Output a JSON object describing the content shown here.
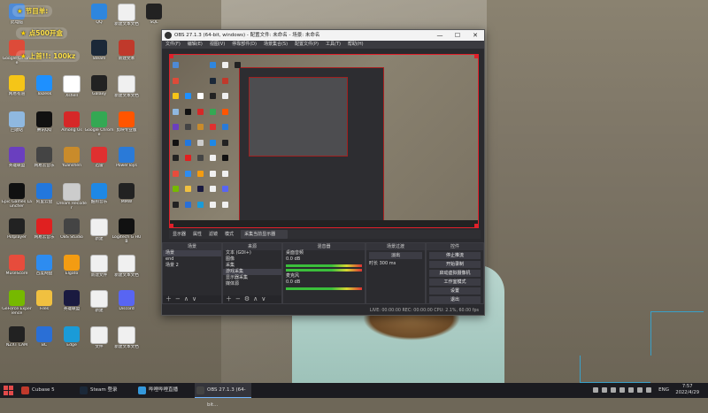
{
  "overlay": {
    "banner1": "节目单:",
    "banner2": "点500开盒",
    "banner3": "上首!!: 100kz"
  },
  "desktop_icons": [
    {
      "label": "此电脑",
      "icon": "pc-icon",
      "color": "#4e8ad6",
      "col": 0,
      "row": 0
    },
    {
      "label": "QQ",
      "icon": "qq-icon",
      "color": "#2e86de",
      "col": 3,
      "row": 0
    },
    {
      "label": "新建文本文档",
      "icon": "doc-icon",
      "color": "#f0f0f0",
      "col": 4,
      "row": 0
    },
    {
      "label": "SQL",
      "icon": "sql-icon",
      "color": "#222222",
      "col": 5,
      "row": 0
    },
    {
      "label": "Google Chrome",
      "icon": "chrome-icon",
      "color": "#dd4b39",
      "col": 0,
      "row": 1
    },
    {
      "label": "Steam",
      "icon": "steam-icon",
      "color": "#1b2838",
      "col": 3,
      "row": 1
    },
    {
      "label": "新建文本",
      "icon": "app-icon",
      "color": "#c0392b",
      "col": 4,
      "row": 1
    },
    {
      "label": "网易有道",
      "icon": "youdao-icon",
      "color": "#f5c518",
      "col": 0,
      "row": 2
    },
    {
      "label": "ToDesk",
      "icon": "todesk-icon",
      "color": "#1e90ff",
      "col": 1,
      "row": 2
    },
    {
      "label": "Xshell",
      "icon": "xshell-icon",
      "color": "#ffffff",
      "col": 2,
      "row": 2
    },
    {
      "label": "Galaxy",
      "icon": "galaxy-icon",
      "color": "#222222",
      "col": 3,
      "row": 2
    },
    {
      "label": "新建文本文档",
      "icon": "doc-icon",
      "color": "#f0f0f0",
      "col": 4,
      "row": 2
    },
    {
      "label": "回收站",
      "icon": "recycle-icon",
      "color": "#8fb8e0",
      "col": 0,
      "row": 3
    },
    {
      "label": "腾讯QQ",
      "icon": "penguin-icon",
      "color": "#111111",
      "col": 1,
      "row": 3
    },
    {
      "label": "Among Us",
      "icon": "amongus-icon",
      "color": "#d62828",
      "col": 2,
      "row": 3
    },
    {
      "label": "Google Chrome",
      "icon": "chrome-icon",
      "color": "#34a853",
      "col": 3,
      "row": 3
    },
    {
      "label": "剪映专业版",
      "icon": "cut-icon",
      "color": "#ff5500",
      "col": 4,
      "row": 3
    },
    {
      "label": "英雄联盟",
      "icon": "game-icon",
      "color": "#6a3fbf",
      "col": 0,
      "row": 4
    },
    {
      "label": "网易云音乐",
      "icon": "music-icon",
      "color": "#444444",
      "col": 1,
      "row": 4
    },
    {
      "label": "Yuanshen",
      "icon": "game-icon",
      "color": "#c98b2b",
      "col": 2,
      "row": 4
    },
    {
      "label": "迅雷",
      "icon": "xunlei-icon",
      "color": "#e03030",
      "col": 3,
      "row": 4
    },
    {
      "label": "PowerToys",
      "icon": "app-icon",
      "color": "#2a7ad8",
      "col": 4,
      "row": 4
    },
    {
      "label": "Epic Games Launcher",
      "icon": "epic-icon",
      "color": "#111111",
      "col": 0,
      "row": 5
    },
    {
      "label": "阿里云盘",
      "icon": "cloud-icon",
      "color": "#2277dd",
      "col": 1,
      "row": 5
    },
    {
      "label": "Dream Recoder",
      "icon": "app-icon",
      "color": "#cccccc",
      "col": 2,
      "row": 5
    },
    {
      "label": "酷狗音乐",
      "icon": "kugou-icon",
      "color": "#1e88e5",
      "col": 3,
      "row": 5
    },
    {
      "label": "MMW",
      "icon": "app-icon",
      "color": "#222222",
      "col": 4,
      "row": 5
    },
    {
      "label": "Potplayer",
      "icon": "chart-icon",
      "color": "#222222",
      "col": 0,
      "row": 6
    },
    {
      "label": "网易云音乐",
      "icon": "netease-icon",
      "color": "#e02020",
      "col": 1,
      "row": 6
    },
    {
      "label": "OBS Studio",
      "icon": "obs-icon",
      "color": "#444444",
      "col": 2,
      "row": 6
    },
    {
      "label": "新建",
      "icon": "doc-icon",
      "color": "#f0f0f0",
      "col": 3,
      "row": 6
    },
    {
      "label": "Logitech G HUB",
      "icon": "logitech-icon",
      "color": "#111111",
      "col": 4,
      "row": 6
    },
    {
      "label": "MuseScore",
      "icon": "app-icon",
      "color": "#e74c3c",
      "col": 0,
      "row": 7
    },
    {
      "label": "百度网盘",
      "icon": "baidu-icon",
      "color": "#2d8cf0",
      "col": 1,
      "row": 7
    },
    {
      "label": "Elgato",
      "icon": "app-icon",
      "color": "#f39c12",
      "col": 2,
      "row": 7
    },
    {
      "label": "新建文件",
      "icon": "doc-icon",
      "color": "#f0f0f0",
      "col": 3,
      "row": 7
    },
    {
      "label": "新建文本文档",
      "icon": "doc-icon",
      "color": "#f0f0f0",
      "col": 4,
      "row": 7
    },
    {
      "label": "GeForce Experience",
      "icon": "nvidia-icon",
      "color": "#76b900",
      "col": 0,
      "row": 8
    },
    {
      "label": "Files",
      "icon": "folder-icon",
      "color": "#f0c040",
      "col": 1,
      "row": 8
    },
    {
      "label": "英雄联盟",
      "icon": "lol-icon",
      "color": "#1a1a40",
      "col": 2,
      "row": 8
    },
    {
      "label": "新建",
      "icon": "doc-icon",
      "color": "#f0f0f0",
      "col": 3,
      "row": 8
    },
    {
      "label": "Discord",
      "icon": "discord-icon",
      "color": "#5865f2",
      "col": 4,
      "row": 8
    },
    {
      "label": "NZXT CAM",
      "icon": "nzxt-icon",
      "color": "#222222",
      "col": 0,
      "row": 9
    },
    {
      "label": "BC",
      "icon": "doc-icon",
      "color": "#2a6fd6",
      "col": 1,
      "row": 9
    },
    {
      "label": "Edge",
      "icon": "edge-icon",
      "color": "#1a9bd8",
      "col": 2,
      "row": 9
    },
    {
      "label": "文件",
      "icon": "doc-icon",
      "color": "#f0f0f0",
      "col": 3,
      "row": 9
    },
    {
      "label": "新建文本文档",
      "icon": "doc-icon",
      "color": "#f0f0f0",
      "col": 4,
      "row": 9
    }
  ],
  "obs": {
    "title": "OBS 27.1.3 (64-bit, windows) - 配置文件: 未命名 - 场景: 未命名",
    "menu": [
      "文件(F)",
      "编辑(E)",
      "视图(V)",
      "停靠部件(D)",
      "场景集合(S)",
      "配置文件(P)",
      "工具(T)",
      "帮助(H)"
    ],
    "window_buttons": [
      "—",
      "☐",
      "✕"
    ],
    "sourcebar": {
      "source": "显示器",
      "properties": "属性",
      "filters": "滤镜",
      "mode_label": "模式",
      "mode_value": "采集当前显示器"
    },
    "scenes": {
      "header": "场景",
      "items": [
        "场景",
        "end",
        "场景 2"
      ]
    },
    "sources": {
      "header": "来源",
      "items": [
        "文本 (GDI+)",
        "图像",
        "采集",
        "游戏采集",
        "显示器采集",
        "媒体源"
      ]
    },
    "mixer": {
      "header": "混音器",
      "tracks": [
        {
          "name": "桌面音频",
          "level": "0.0 dB"
        },
        {
          "name": "麦克风",
          "level": "0.0 dB"
        }
      ]
    },
    "transitions": {
      "header": "场景过渡",
      "type": "淡出",
      "duration_label": "时长",
      "duration": "300 ms"
    },
    "controls": {
      "header": "控件",
      "buttons": [
        "停止推流",
        "开始录制",
        "启动虚拟摄像机",
        "工作室模式",
        "设置",
        "退出"
      ]
    },
    "status": "LIVE: 00:00:00   REC: 00:00:00   CPU: 2.1%, 60.00 fps"
  },
  "taskbar": {
    "tasks": [
      {
        "label": "Cubase 5",
        "color": "#c0392b"
      },
      {
        "label": "Steam 登录",
        "color": "#1b2838"
      },
      {
        "label": "哔哩哔哩直播",
        "color": "#3498db"
      },
      {
        "label": "OBS 27.1.3 (64-bit...",
        "color": "#444444"
      }
    ],
    "language": "ENG",
    "time": "7:57",
    "date": "2022/4/29"
  }
}
